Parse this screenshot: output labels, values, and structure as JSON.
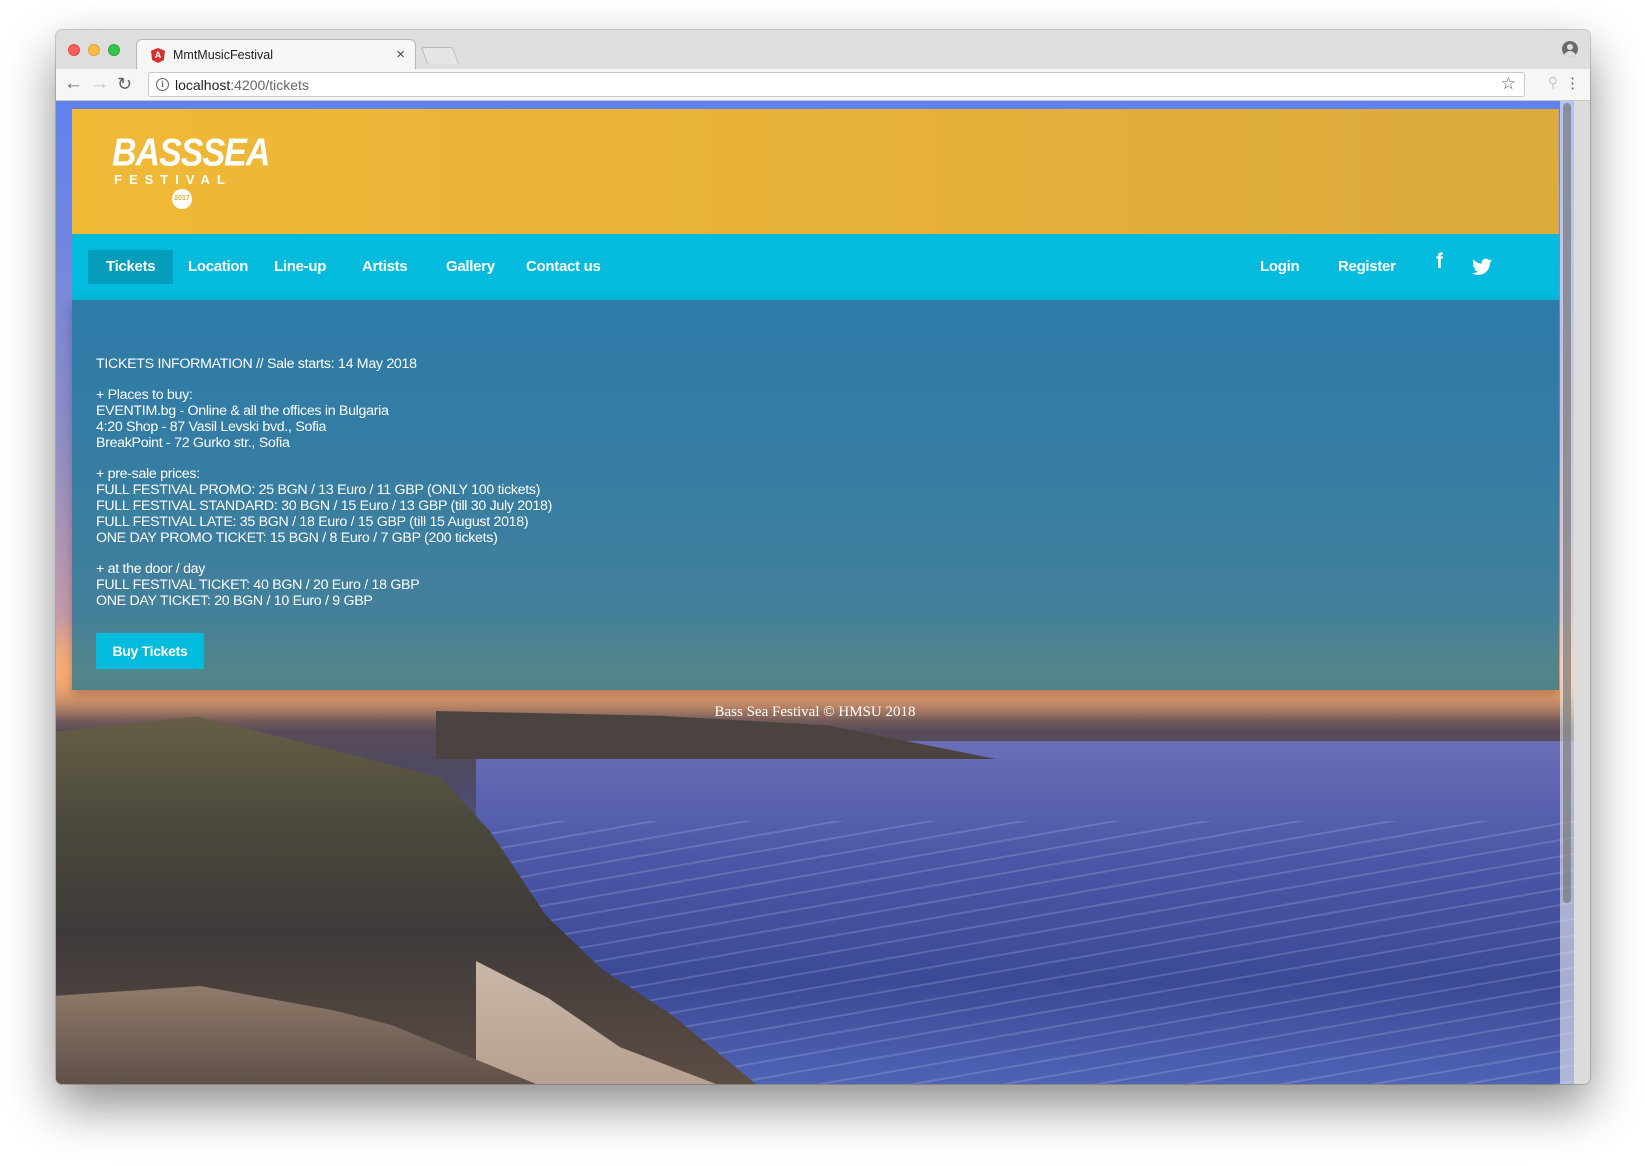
{
  "browser": {
    "tab_title": "MmtMusicFestival",
    "tab_close": "×",
    "url_host": "localhost",
    "url_path": ":4200/tickets",
    "icons": [
      "back-icon",
      "forward-icon",
      "reload-icon",
      "info-icon",
      "star-icon",
      "extension-icon",
      "menu-icon",
      "profile-icon"
    ]
  },
  "site": {
    "logo": {
      "main": "BASSSEA",
      "sub": "FESTIVAL",
      "year": "2017"
    },
    "nav": {
      "items": [
        {
          "label": "Tickets",
          "active": true
        },
        {
          "label": "Location",
          "active": false
        },
        {
          "label": "Line-up",
          "active": false
        },
        {
          "label": "Artists",
          "active": false
        },
        {
          "label": "Gallery",
          "active": false
        },
        {
          "label": "Contact us",
          "active": false
        }
      ],
      "right": {
        "login": "Login",
        "register": "Register"
      },
      "social": [
        "facebook-icon",
        "twitter-icon"
      ]
    },
    "tickets": {
      "heading": "TICKETS INFORMATION // Sale starts: 14 May 2018",
      "places_title": "+ Places to buy:",
      "places": [
        "EVENTIM.bg - Online & all the offices in Bulgaria",
        "4:20 Shop - 87 Vasil Levski bvd., Sofia",
        "BreakPoint - 72 Gurko str., Sofia"
      ],
      "presale_title": "+ pre-sale prices:",
      "presale": [
        "FULL FESTIVAL PROMO: 25 BGN / 13 Euro / 11 GBP (ONLY 100 tickets)",
        "FULL FESTIVAL STANDARD: 30 BGN / 15 Euro / 13 GBP (till 30 July 2018)",
        "FULL FESTIVAL LATE: 35 BGN / 18 Euro / 15 GBP (till 15 August 2018)",
        "ONE DAY PROMO TICKET: 15 BGN / 8 Euro / 7 GBP (200 tickets)"
      ],
      "door_title": "+ at the door / day",
      "door": [
        "FULL FESTIVAL TICKET: 40 BGN / 20 Euro / 18 GBP",
        "ONE DAY TICKET: 20 BGN / 10 Euro / 9 GBP"
      ],
      "buy_button": "Buy Tickets"
    },
    "footer": "Bass Sea Festival © HMSU 2018"
  },
  "colors": {
    "header": "#f0b936",
    "nav": "#02bbdd",
    "nav_active": "#039dbb",
    "content_overlay": "#107696"
  }
}
